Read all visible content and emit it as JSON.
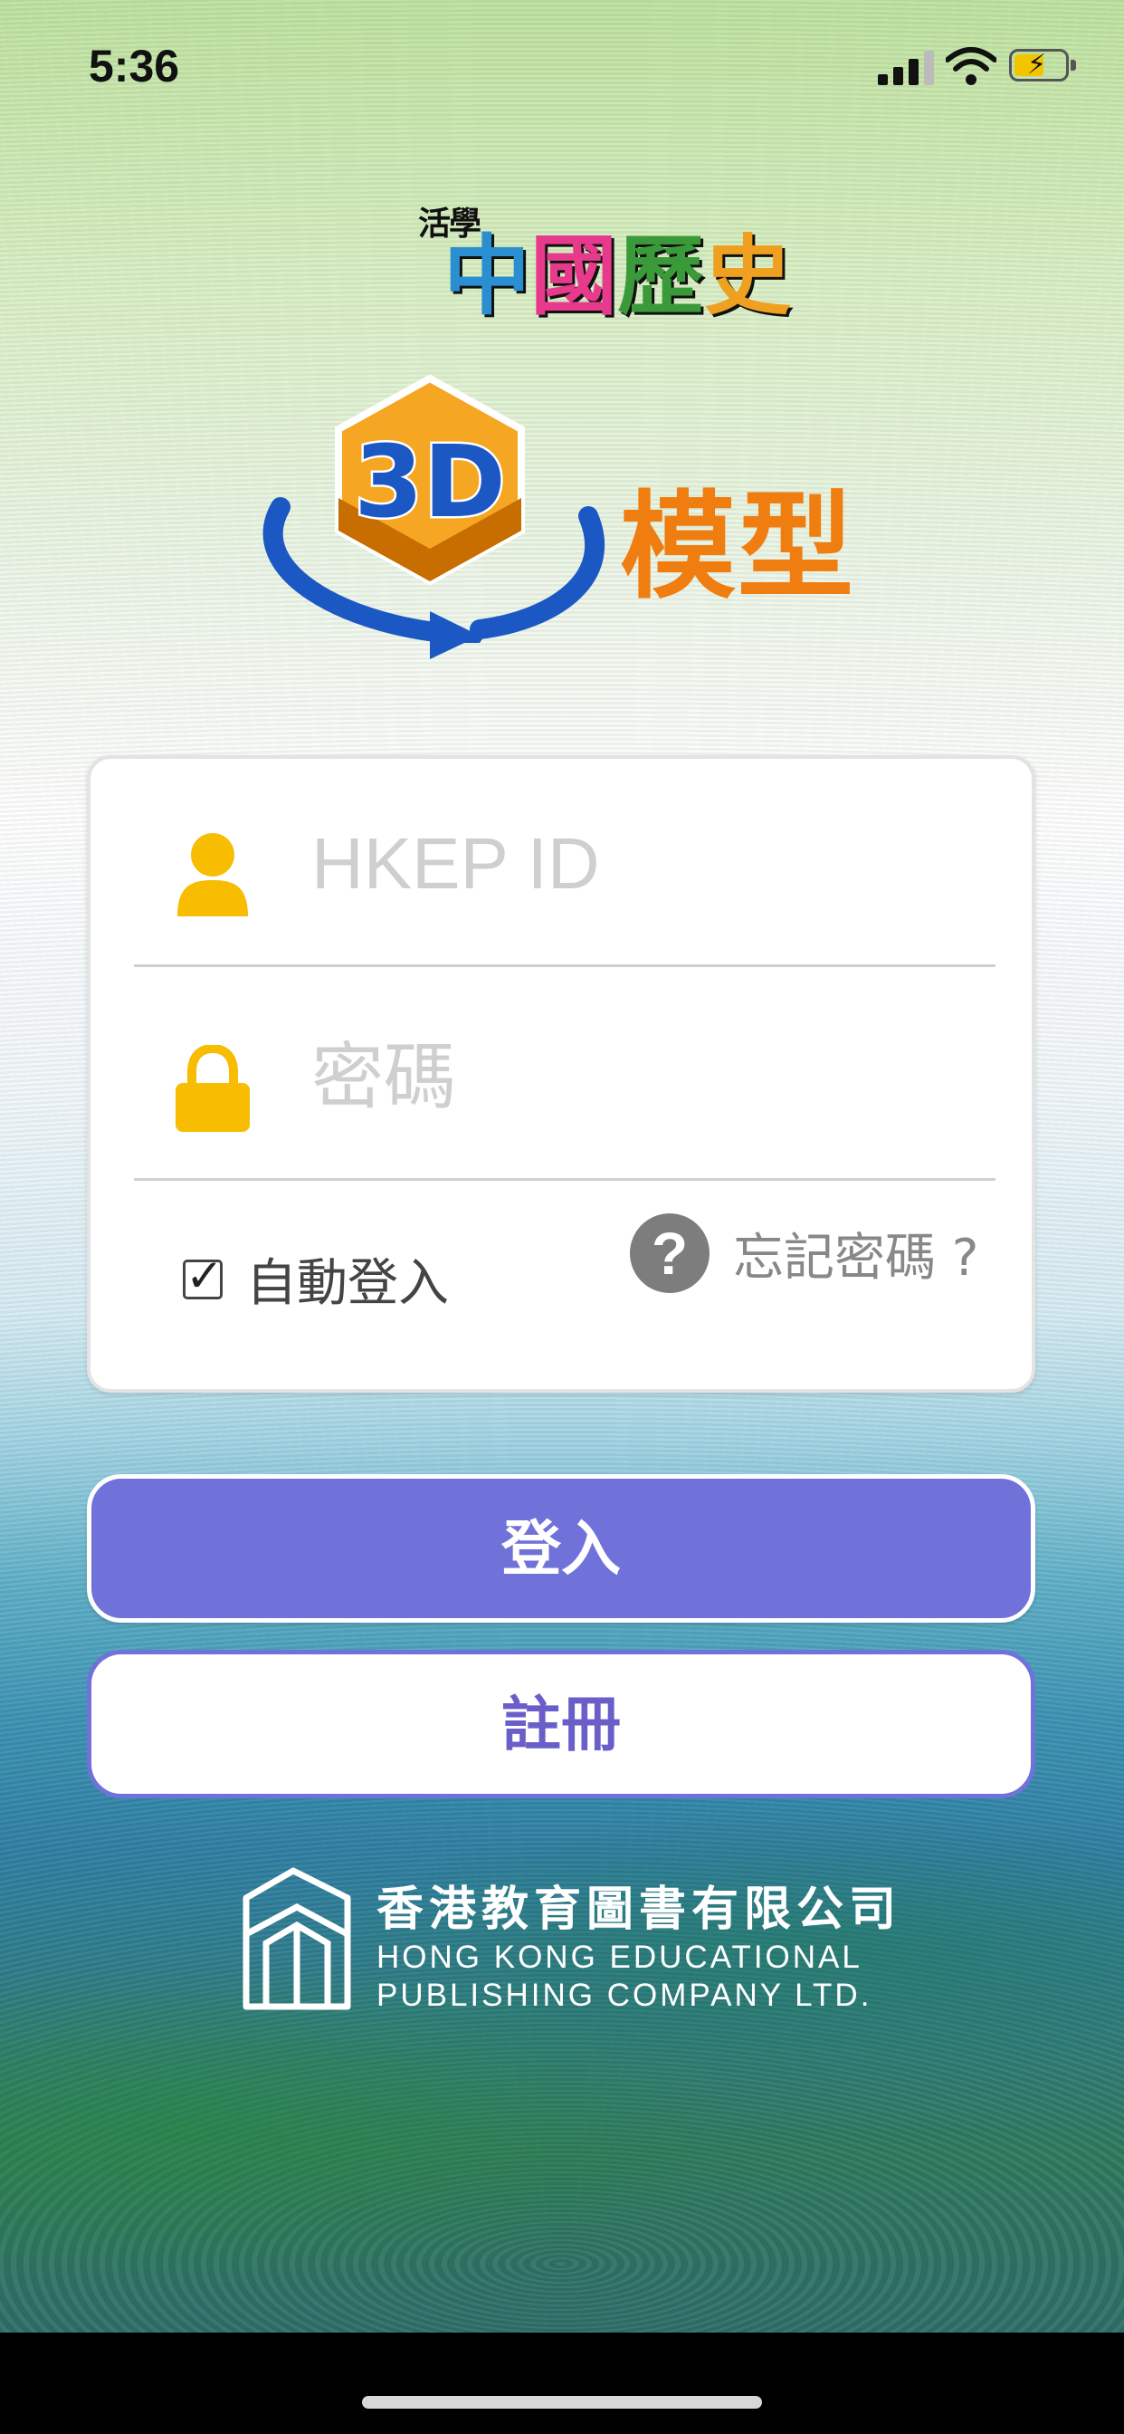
{
  "status_bar": {
    "time": "5:36"
  },
  "branding": {
    "series_small": "活學",
    "series_chars": [
      {
        "char": "中",
        "color": "#2a8fd0"
      },
      {
        "char": "國",
        "color": "#e83a8c"
      },
      {
        "char": "歷",
        "color": "#3a9a3a"
      },
      {
        "char": "史",
        "color": "#f0a020"
      }
    ],
    "badge_text": "3D",
    "model_title": "模型"
  },
  "login_form": {
    "user_placeholder": "HKEP ID",
    "password_placeholder": "密碼",
    "auto_login_label": "自動登入",
    "auto_login_checked": true,
    "forgot_password_label": "忘記密碼 ?",
    "help_glyph": "?"
  },
  "buttons": {
    "login_label": "登入",
    "register_label": "註冊"
  },
  "publisher": {
    "chinese_name": "香港教育圖書有限公司",
    "english_line1": "HONG KONG EDUCATIONAL",
    "english_line2": "PUBLISHING COMPANY LTD."
  },
  "colors": {
    "accent": "#7072d9",
    "orange": "#f07d10",
    "icon_yellow": "#f8bc00",
    "arrow_blue": "#1b58c4"
  }
}
